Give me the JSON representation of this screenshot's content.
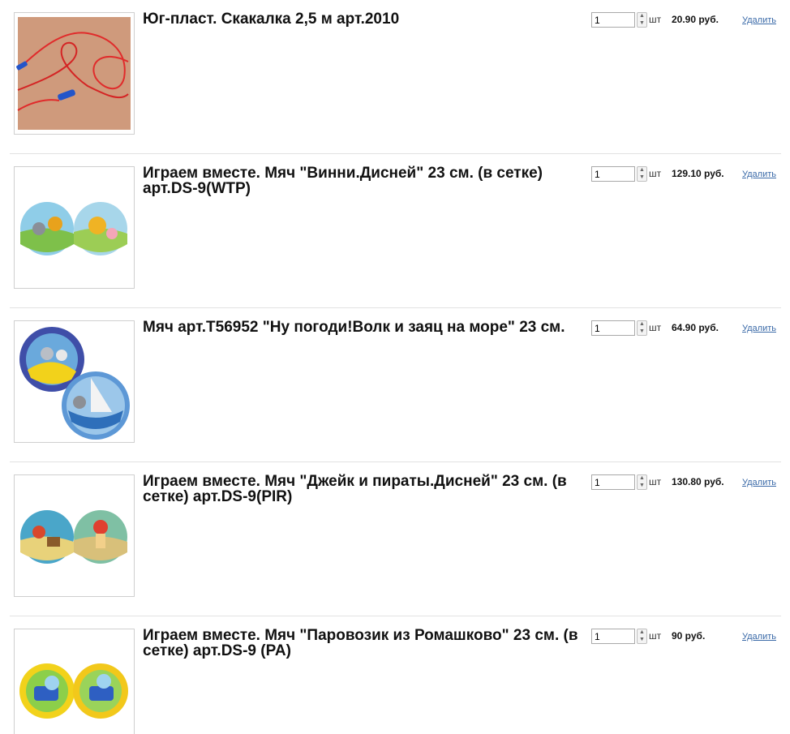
{
  "cart": {
    "items": [
      {
        "title": "Юг-пласт. Скакалка 2,5 м арт.2010",
        "qty": "1",
        "unit": "шт",
        "price": "20.90 руб.",
        "remove_label": "Удалить"
      },
      {
        "title": "Играем вместе. Мяч \"Винни.Дисней\" 23 см. (в сетке) арт.DS-9(WTP)",
        "qty": "1",
        "unit": "шт",
        "price": "129.10 руб.",
        "remove_label": "Удалить"
      },
      {
        "title": "Мяч арт.Т56952 \"Ну погоди!Волк и заяц на море\" 23 см.",
        "qty": "1",
        "unit": "шт",
        "price": "64.90 руб.",
        "remove_label": "Удалить"
      },
      {
        "title": "Играем вместе. Мяч \"Джейк и пираты.Дисней\" 23 см. (в сетке) арт.DS-9(PIR)",
        "qty": "1",
        "unit": "шт",
        "price": "130.80 руб.",
        "remove_label": "Удалить"
      },
      {
        "title": "Играем вместе. Мяч \"Паровозик из Ромашково\" 23 см. (в сетке) арт.DS-9 (PA)",
        "qty": "1",
        "unit": "шт",
        "price": "90 руб.",
        "remove_label": "Удалить"
      }
    ]
  },
  "colors": {
    "link": "#3b6aa8",
    "border": "#cfcfcf"
  }
}
